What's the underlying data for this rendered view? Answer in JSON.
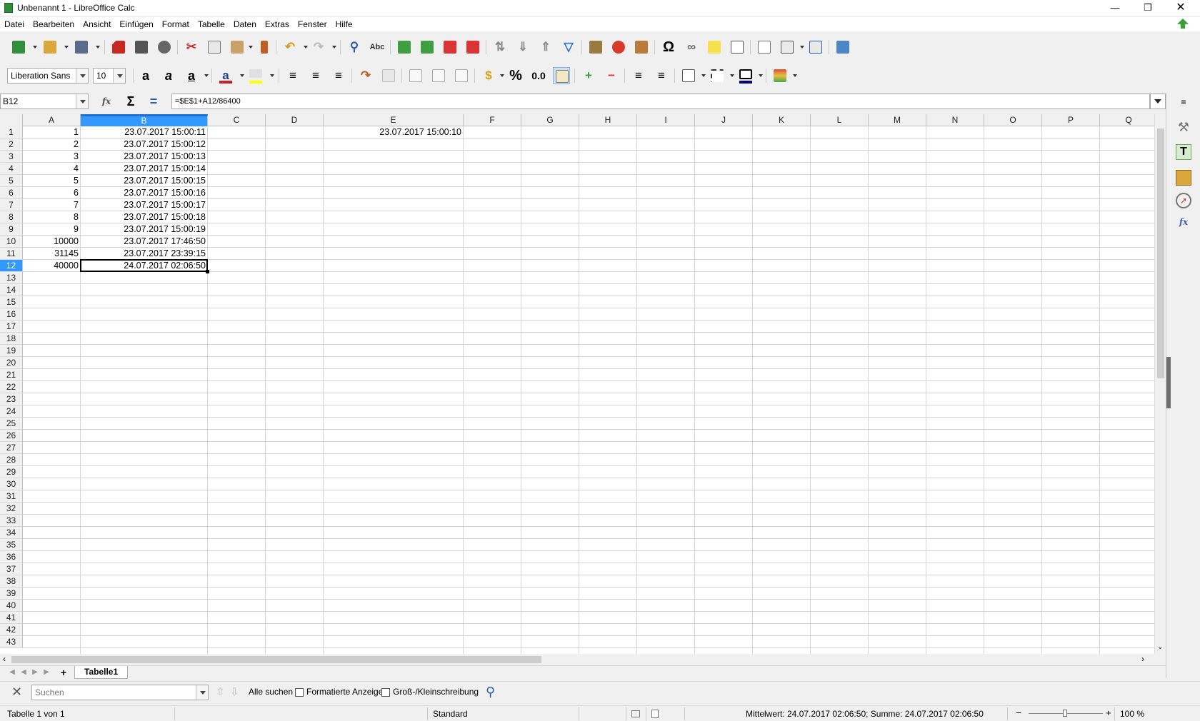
{
  "window": {
    "title": "Unbenannt 1 - LibreOffice Calc"
  },
  "menu": [
    "Datei",
    "Bearbeiten",
    "Ansicht",
    "Einfügen",
    "Format",
    "Tabelle",
    "Daten",
    "Extras",
    "Fenster",
    "Hilfe"
  ],
  "font": {
    "name": "Liberation Sans",
    "size": "10"
  },
  "formula": {
    "cell_ref": "B12",
    "content": "=$E$1+A12/86400"
  },
  "columns": [
    "A",
    "B",
    "C",
    "D",
    "E",
    "F",
    "G",
    "H",
    "I",
    "J",
    "K",
    "L",
    "M",
    "N",
    "O",
    "P",
    "Q"
  ],
  "rows": [
    "1",
    "2",
    "3",
    "4",
    "5",
    "6",
    "7",
    "8",
    "9",
    "10",
    "11",
    "12",
    "13",
    "14",
    "15",
    "16",
    "17",
    "18",
    "19",
    "20",
    "21",
    "22",
    "23",
    "24",
    "25",
    "26",
    "27",
    "28",
    "29",
    "30",
    "31",
    "32",
    "33",
    "34",
    "35",
    "36",
    "37",
    "38",
    "39",
    "40",
    "41",
    "42",
    "43"
  ],
  "cells": {
    "A": [
      "1",
      "2",
      "3",
      "4",
      "5",
      "6",
      "7",
      "8",
      "9",
      "10000",
      "31145",
      "40000"
    ],
    "B": [
      "23.07.2017 15:00:11",
      "23.07.2017 15:00:12",
      "23.07.2017 15:00:13",
      "23.07.2017 15:00:14",
      "23.07.2017 15:00:15",
      "23.07.2017 15:00:16",
      "23.07.2017 15:00:17",
      "23.07.2017 15:00:18",
      "23.07.2017 15:00:19",
      "23.07.2017 17:46:50",
      "23.07.2017 23:39:15",
      "24.07.2017 02:06:50"
    ],
    "E1": "23.07.2017 15:00:10"
  },
  "sheet_tabs": [
    "Tabelle1"
  ],
  "find": {
    "placeholder": "Suchen",
    "find_all": "Alle suchen",
    "formatted_display": "Formatierte Anzeige",
    "match_case": "Groß-/Kleinschreibung"
  },
  "status": {
    "sheet": "Tabelle 1 von 1",
    "style": "Standard",
    "summary": "Mittelwert: 24.07.2017 02:06:50; Summe: 24.07.2017 02:06:50",
    "zoom": "100 %"
  }
}
